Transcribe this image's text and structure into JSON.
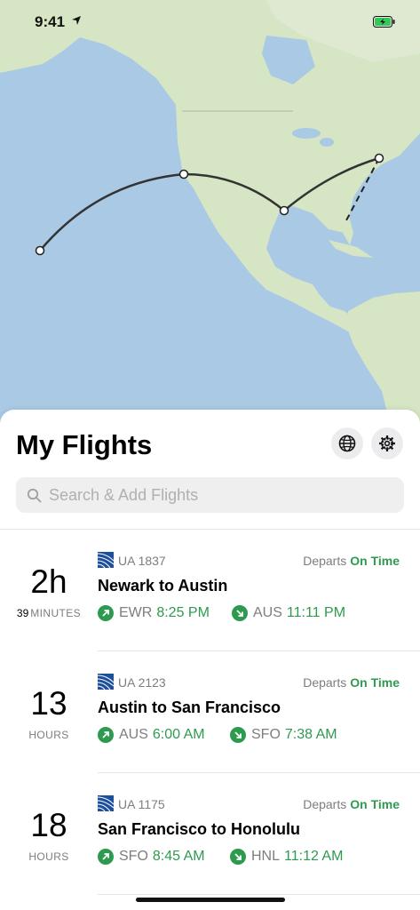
{
  "status_bar": {
    "time": "9:41"
  },
  "sheet": {
    "title": "My Flights",
    "search_placeholder": "Search & Add Flights"
  },
  "colors": {
    "accent_green": "#2e9a4f",
    "map_water": "#a9c9e4",
    "map_land": "#d6e6c4"
  },
  "icons": [
    "location-arrow-icon",
    "battery-icon",
    "globe-icon",
    "gear-icon",
    "search-icon",
    "airline-logo-icon",
    "departure-arrow-icon",
    "arrival-arrow-icon"
  ],
  "flights": [
    {
      "big": "2h",
      "minutes": "39",
      "unit": "MINUTES",
      "flight_no": "UA 1837",
      "status_label": "Departs",
      "status_value": "On Time",
      "route": "Newark to Austin",
      "dep_code": "EWR",
      "dep_time": "8:25 PM",
      "arr_code": "AUS",
      "arr_time": "11:11 PM"
    },
    {
      "big": "13",
      "unit": "HOURS",
      "flight_no": "UA 2123",
      "status_label": "Departs",
      "status_value": "On Time",
      "route": "Austin to San Francisco",
      "dep_code": "AUS",
      "dep_time": "6:00 AM",
      "arr_code": "SFO",
      "arr_time": "7:38 AM"
    },
    {
      "big": "18",
      "unit": "HOURS",
      "flight_no": "UA 1175",
      "status_label": "Departs",
      "status_value": "On Time",
      "route": "San Francisco to Honolulu",
      "dep_code": "SFO",
      "dep_time": "8:45 AM",
      "arr_code": "HNL",
      "arr_time": "11:12 AM"
    }
  ]
}
